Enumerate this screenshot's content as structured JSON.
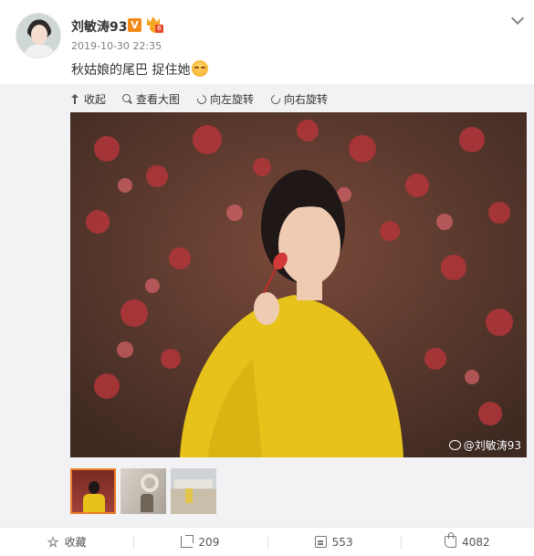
{
  "post": {
    "username": "刘敏涛93",
    "verified_badge": "V",
    "timestamp": "2019-10-30 22:35",
    "text": "秋姑娘的尾巴 捉住她",
    "emoji": "smirk-emoji"
  },
  "media_toolbar": {
    "collapse": "收起",
    "view_large": "查看大图",
    "rotate_left": "向左旋转",
    "rotate_right": "向右旋转"
  },
  "photo": {
    "watermark": "@刘敏涛93"
  },
  "thumbnails": [
    {
      "name": "thumb-1",
      "active": true
    },
    {
      "name": "thumb-2",
      "active": false
    },
    {
      "name": "thumb-3",
      "active": false
    }
  ],
  "actions": {
    "favorite": "收藏",
    "repost_count": "209",
    "comment_count": "553",
    "like_count": "4082"
  },
  "colors": {
    "accent": "#ea7d29",
    "sweater_yellow": "#e6c21b",
    "leaf_red": "#b3353a"
  }
}
